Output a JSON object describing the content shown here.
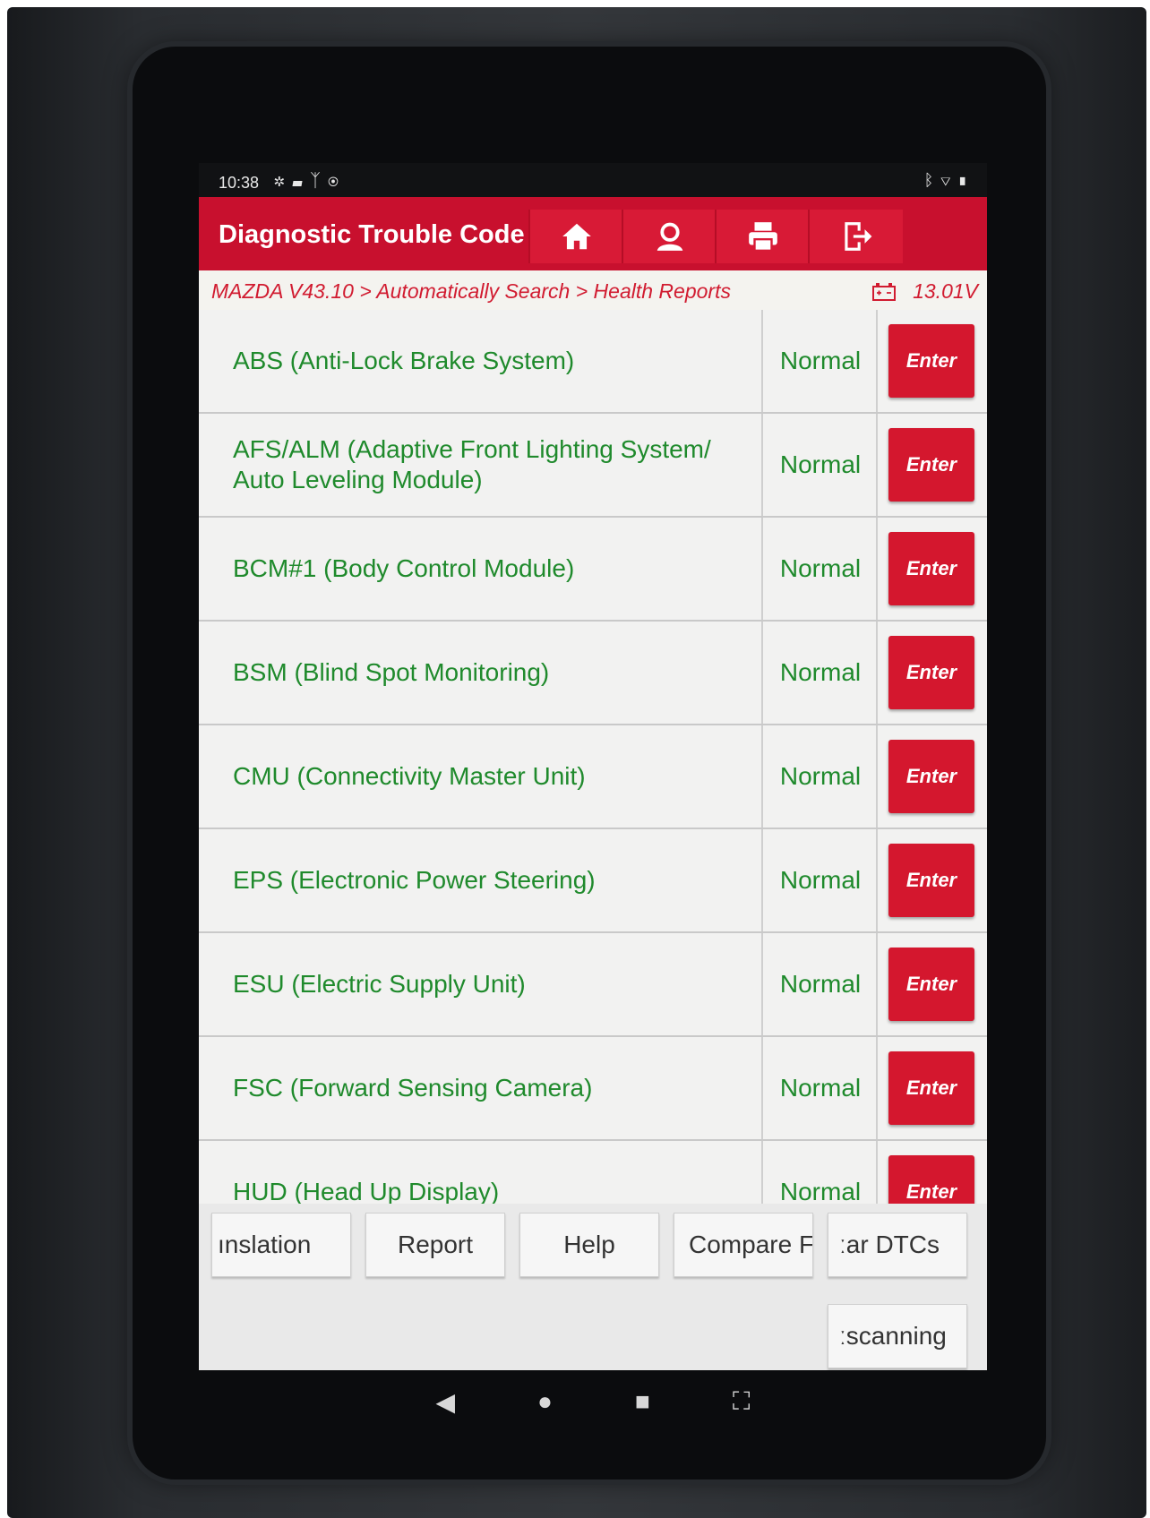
{
  "status_bar": {
    "time": "10:38",
    "left_icons": [
      "settings-icon",
      "photo-icon",
      "stethoscope-icon",
      "bluetooth-circle-icon"
    ],
    "right_icons": [
      "bluetooth-icon",
      "wifi-icon",
      "battery-icon"
    ]
  },
  "header": {
    "title": "Diagnostic Trouble Code",
    "buttons": [
      "home-icon",
      "user-icon",
      "print-icon",
      "exit-icon"
    ]
  },
  "breadcrumb": {
    "path": "MAZDA V43.10 > Automatically Search > Health Reports",
    "voltage": "13.01V"
  },
  "modules": [
    {
      "name": "ABS (Anti-Lock Brake System)",
      "status": "Normal",
      "action": "Enter"
    },
    {
      "name": "AFS/ALM (Adaptive Front Lighting System/ Auto Leveling Module)",
      "status": "Normal",
      "action": "Enter"
    },
    {
      "name": "BCM#1 (Body Control Module)",
      "status": "Normal",
      "action": "Enter"
    },
    {
      "name": "BSM (Blind Spot Monitoring)",
      "status": "Normal",
      "action": "Enter"
    },
    {
      "name": "CMU (Connectivity Master Unit)",
      "status": "Normal",
      "action": "Enter"
    },
    {
      "name": "EPS (Electronic Power Steering)",
      "status": "Normal",
      "action": "Enter"
    },
    {
      "name": "ESU (Electric Supply Unit)",
      "status": "Normal",
      "action": "Enter"
    },
    {
      "name": "FSC (Forward Sensing Camera)",
      "status": "Normal",
      "action": "Enter"
    },
    {
      "name": "HUD (Head Up Display)",
      "status": "Normal",
      "action": "Enter"
    }
  ],
  "footer": {
    "translation": "ınslation",
    "report": "Report",
    "help": "Help",
    "compare": "Compare F",
    "clear_dtcs": "ːar DTCs",
    "rescanning": "ːscanning"
  },
  "colors": {
    "header_red": "#c8102e",
    "text_green": "#1f8a2c",
    "enter_red": "#d4172e"
  }
}
